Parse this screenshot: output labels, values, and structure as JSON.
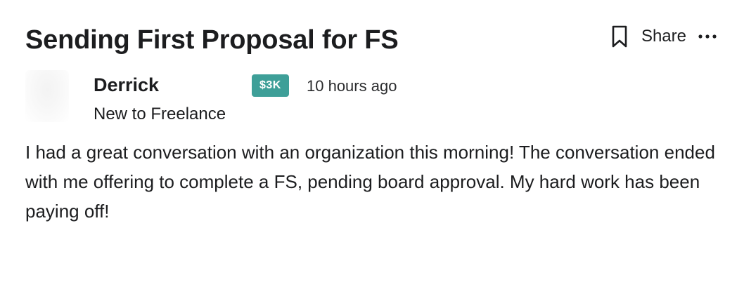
{
  "post": {
    "title": "Sending First Proposal for FS",
    "share_label": "Share",
    "author": {
      "name": "Derrick",
      "subtitle": "New to Freelance",
      "badge": "$3K"
    },
    "timestamp": "10 hours ago",
    "body": "I had a great conversation with an organization this morning! The conversation ended with me offering to complete a FS, pending board approval. My hard work has been paying off!"
  },
  "icons": {
    "bookmark": "bookmark-icon",
    "more": "more-horizontal-icon"
  },
  "colors": {
    "badge_background": "#3e9f98",
    "text": "#1c1d1f"
  }
}
